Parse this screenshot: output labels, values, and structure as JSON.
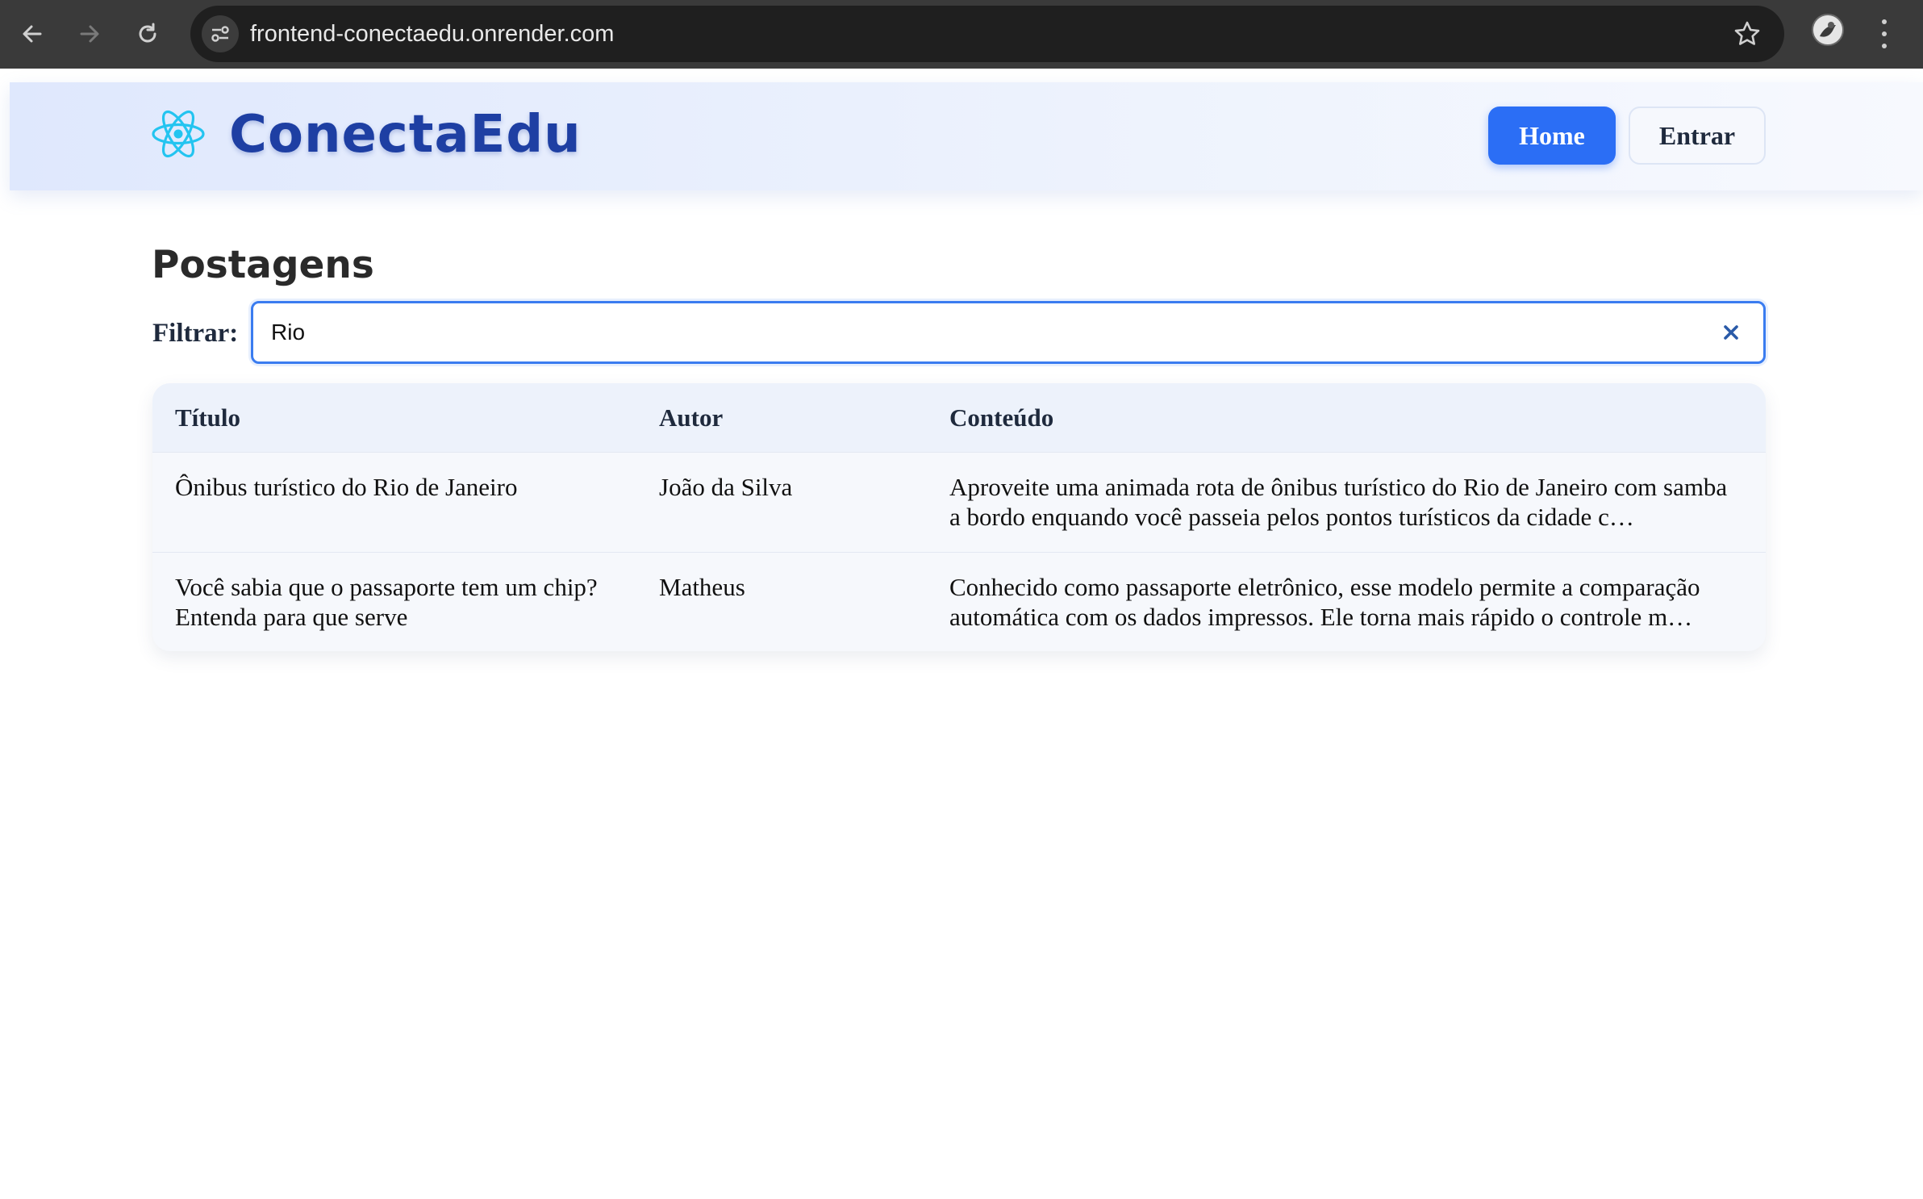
{
  "browser": {
    "url": "frontend-conectaedu.onrender.com"
  },
  "header": {
    "brand": "ConectaEdu",
    "nav": {
      "home": "Home",
      "login": "Entrar"
    },
    "colors": {
      "primary": "#2b6ef5",
      "brand": "#1e3fa3",
      "logo": "#23c4f0"
    }
  },
  "main": {
    "title": "Postagens",
    "filter": {
      "label": "Filtrar:",
      "value": "Rio"
    },
    "table": {
      "columns": [
        "Título",
        "Autor",
        "Conteúdo"
      ],
      "rows": [
        {
          "title": "Ônibus turístico do Rio de Janeiro",
          "author": "João da Silva",
          "content": "Aproveite uma animada rota de ônibus turístico do Rio de Janeiro com samba a bordo enquando você passeia pelos pontos turísticos da cidade c…"
        },
        {
          "title": "Você sabia que o passaporte tem um chip? Entenda para que serve",
          "author": "Matheus",
          "content": "Conhecido como passaporte eletrônico, esse modelo permite a comparação automática com os dados impressos. Ele torna mais rápido o controle m…"
        }
      ]
    }
  }
}
